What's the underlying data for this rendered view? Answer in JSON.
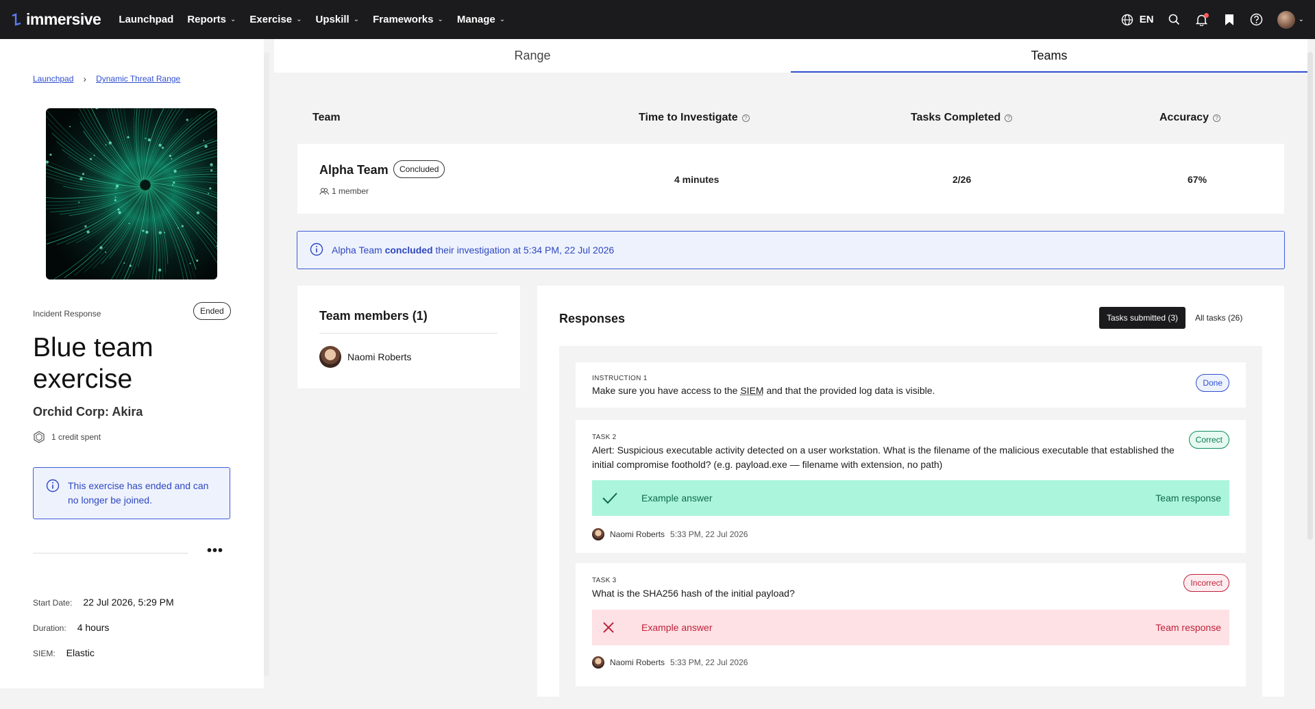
{
  "nav": {
    "brand": "immersive",
    "items": [
      {
        "label": "Launchpad",
        "has_menu": false
      },
      {
        "label": "Reports",
        "has_menu": true
      },
      {
        "label": "Exercise",
        "has_menu": true
      },
      {
        "label": "Upskill",
        "has_menu": true
      },
      {
        "label": "Frameworks",
        "has_menu": true
      },
      {
        "label": "Manage",
        "has_menu": true
      }
    ],
    "language": "EN",
    "icons": [
      "globe-icon",
      "search-icon",
      "bell-icon",
      "bookmark-icon",
      "help-icon"
    ]
  },
  "sidebar": {
    "breadcrumb": [
      "Launchpad",
      "Dynamic Threat Range"
    ],
    "category": "Incident Response",
    "status": "Ended",
    "title": "Blue team exercise",
    "subtitle": "Orchid Corp: Akira",
    "credits": "1 credit spent",
    "ended_message": "This exercise has ended and can no longer be joined.",
    "meta": {
      "start_label": "Start Date:",
      "start_value": "22 Jul 2026, 5:29 PM",
      "duration_label": "Duration:",
      "duration_value": "4 hours",
      "siem_label": "SIEM:",
      "siem_value": "Elastic"
    }
  },
  "tabs": [
    {
      "label": "Range",
      "active": false
    },
    {
      "label": "Teams",
      "active": true
    }
  ],
  "team_table": {
    "headers": [
      "Team",
      "Time to Investigate",
      "Tasks Completed",
      "Accuracy"
    ],
    "row": {
      "name": "Alpha Team",
      "status": "Concluded",
      "members": "1 member",
      "time": "4 minutes",
      "tasks": "2/26",
      "accuracy": "67%"
    }
  },
  "info_bar": {
    "team": "Alpha Team",
    "verb": "concluded",
    "rest": "their investigation at 5:34 PM, 22 Jul 2026"
  },
  "members_card": {
    "title": "Team members (1)",
    "members": [
      "Naomi Roberts"
    ]
  },
  "responses": {
    "title": "Responses",
    "filter_active": "Tasks submitted (3)",
    "filter_other": "All tasks (26)",
    "items": [
      {
        "tag": "INSTRUCTION 1",
        "text_before": "Make sure you have access to the ",
        "abbr": "SIEM",
        "text_after": " and that the provided log data is visible.",
        "badge": "Done"
      },
      {
        "tag": "TASK 2",
        "text": "Alert: Suspicious executable activity detected on a user workstation. What is the filename of the malicious executable that established the initial compromise foothold? (e.g. payload.exe — filename with extension, no path)",
        "badge": "Correct",
        "answer": "Example answer",
        "response_label": "Team response",
        "author": "Naomi Roberts",
        "time": "5:33 PM, 22 Jul 2026"
      },
      {
        "tag": "TASK 3",
        "text": "What is the SHA256 hash of the initial payload?",
        "badge": "Incorrect",
        "answer": "Example answer",
        "response_label": "Team response",
        "author": "Naomi Roberts",
        "time": "5:33 PM, 22 Jul 2026"
      }
    ]
  },
  "colors": {
    "nav_bg": "#1b1b1d",
    "accent": "#2f4fd0",
    "correct_bg": "#abf5dc",
    "incorrect_bg": "#fde1e4"
  }
}
